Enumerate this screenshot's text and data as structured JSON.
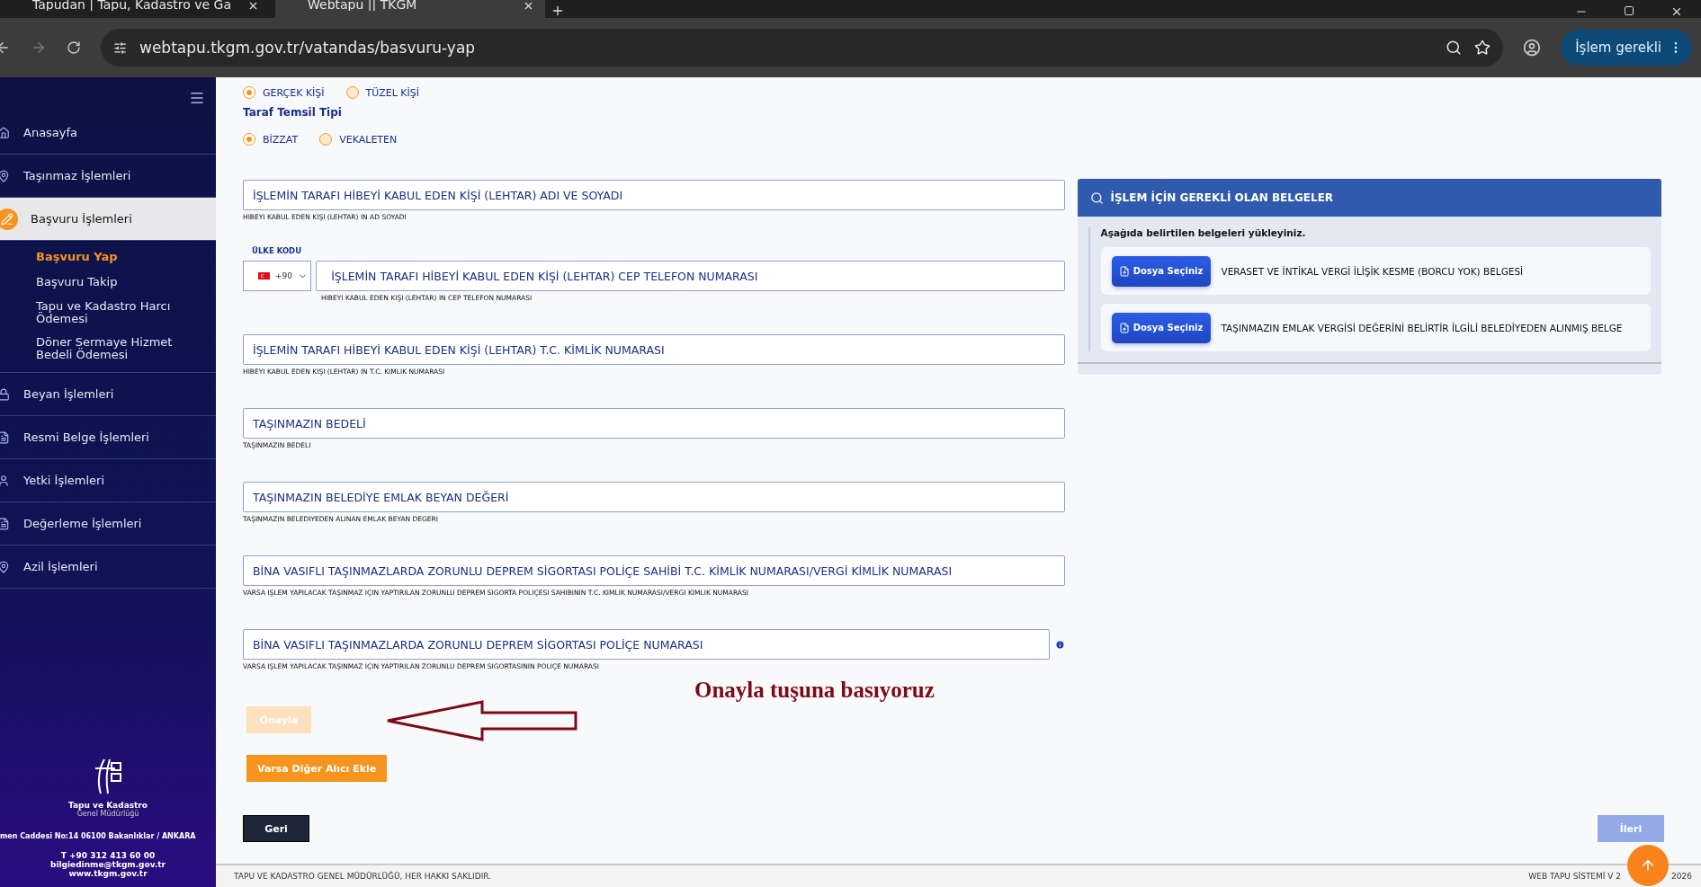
{
  "browser": {
    "tabs": [
      {
        "title": "Tapudan | Tapu, Kadastro ve Ga",
        "selected": false
      },
      {
        "title": "Webtapu || TKGM",
        "selected": true
      }
    ],
    "url": "webtapu.tkgm.gov.tr/vatandas/basvuru-yap",
    "action_button": "İşlem gerekli"
  },
  "sidebar": {
    "items": [
      {
        "label": "Anasayfa",
        "selected": false,
        "expanded": false
      },
      {
        "label": "Taşınmaz İşlemleri",
        "selected": false,
        "expanded": false
      },
      {
        "label": "Başvuru İşlemleri",
        "selected": true,
        "expanded": true,
        "children": [
          {
            "label": "Başvuru Yap",
            "selected": true
          },
          {
            "label": "Başvuru Takip",
            "selected": false
          },
          {
            "label": "Tapu ve Kadastro Harcı Ödemesi",
            "selected": false
          },
          {
            "label": "Döner Sermaye Hizmet Bedeli Ödemesi",
            "selected": false
          }
        ]
      },
      {
        "label": "Beyan İşlemleri",
        "selected": false,
        "expanded": false
      },
      {
        "label": "Resmi Belge İşlemleri",
        "selected": false,
        "expanded": false
      },
      {
        "label": "Yetki İşlemleri",
        "selected": false,
        "expanded": false
      },
      {
        "label": "Değerleme İşlemleri",
        "selected": false,
        "expanded": false
      },
      {
        "label": "Azil İşlemleri",
        "selected": false,
        "expanded": false
      }
    ],
    "logo_title": "Tapu ve Kadastro",
    "logo_subtitle": "Genel Müdürlüğü",
    "address": "men Caddesi No:14 06100 Bakanlıklar / ANKARA",
    "phone": "T +90 312 413 60 00",
    "email": "bilgiedinme@tkgm.gov.tr",
    "website": "www.tkgm.gov.tr"
  },
  "form": {
    "person_type": [
      {
        "label": "GERÇEK KİŞİ",
        "selected": true
      },
      {
        "label": "TÜZEL KİŞİ",
        "selected": false
      }
    ],
    "representation_label": "Taraf Temsil Tipi",
    "representation": [
      {
        "label": "BİZZAT",
        "selected": true
      },
      {
        "label": "VEKALETEN",
        "selected": false
      }
    ],
    "fields": [
      {
        "kind": "text",
        "placeholder": "İŞLEMİN TARAFI HİBEYİ KABUL EDEN KİŞİ (LEHTAR) ADI VE SOYADI",
        "helper": "HIBEYI KABUL EDEN KIŞI (LEHTAR) IN AD SOYADI"
      },
      {
        "kind": "phone",
        "country_label": "ÜLKE KODU",
        "country_code": "+90",
        "placeholder": "İŞLEMİN TARAFI HİBEYİ KABUL EDEN KİŞİ (LEHTAR) CEP TELEFON NUMARASI",
        "helper": "HIBEYI KABUL EDEN KIŞI (LEHTAR) IN CEP TELEFON NUMARASI"
      },
      {
        "kind": "text",
        "placeholder": "İŞLEMİN TARAFI HİBEYİ KABUL EDEN KİŞİ (LEHTAR) T.C. KİMLİK NUMARASI",
        "helper": "HIBEYI KABUL EDEN KIŞI (LEHTAR) IN T.C. KIMLIK NUMARASI"
      },
      {
        "kind": "text",
        "placeholder": "TAŞINMAZIN BEDELİ",
        "helper": "TAŞINMAZIN BEDELI"
      },
      {
        "kind": "text",
        "placeholder": "TAŞINMAZIN BELEDİYE EMLAK BEYAN DEĞERİ",
        "helper": "TAŞINMAZIN BELEDIYEDEN ALINAN EMLAK BEYAN DEGERI"
      },
      {
        "kind": "text",
        "placeholder": "BİNA VASIFLI TAŞINMAZLARDA ZORUNLU DEPREM SİGORTASI POLİÇE SAHİBİ T.C. KİMLİK NUMARASI/VERGİ KİMLİK NUMARASI",
        "helper": "VARSA IŞLEM YAPILACAK TAŞINMAZ IÇIN YAPTIRILAN ZORUNLU DEPREM SIGORTA POLIÇESI SAHIBININ T.C. KIMLIK NUMARASI/VERGI KIMLIK NUMARASI"
      },
      {
        "kind": "info",
        "placeholder": "BİNA VASIFLI TAŞINMAZLARDA ZORUNLU DEPREM SİGORTASI POLİÇE NUMARASI",
        "helper": "VARSA IŞLEM YAPILACAK TAŞINMAZ IÇIN YAPTIRILAN ZORUNLU DEPREM SIGORTASININ POLIÇE NUMARASI"
      }
    ],
    "confirm_button": {
      "label": "Onayla",
      "disabled": true
    },
    "add_button": "Varsa Diğer Alıcı Ekle",
    "annotation": "Onayla tuşuna basıyoruz"
  },
  "documents": {
    "title": "İŞLEM İÇİN GEREKLİ OLAN BELGELER",
    "intro": "Aşağıda belirtilen belgeleri yükleyiniz.",
    "items": [
      {
        "button": "Dosya Seçiniz",
        "name": "VERASET VE İNTİKAL VERGİ İLİŞİK KESME (BORCU YOK) BELGESİ"
      },
      {
        "button": "Dosya Seçiniz",
        "name": "TAŞINMAZIN EMLAK VERGİSİ DEĞERİNİ BELİRTİR İLGİLİ BELEDİYEDEN ALINMIŞ BELGE"
      }
    ]
  },
  "nav": {
    "back": {
      "label": "Geri",
      "disabled": false
    },
    "next": {
      "label": "İleri",
      "disabled": true
    }
  },
  "footer": {
    "copyright": "TAPU VE KADASTRO GENEL MÜDÜRLÜĞÜ, HER HAKKI SAKLIDIR.",
    "version_start": "WEB TAPU SİSTEMİ V 2",
    "version_end": "2026"
  }
}
